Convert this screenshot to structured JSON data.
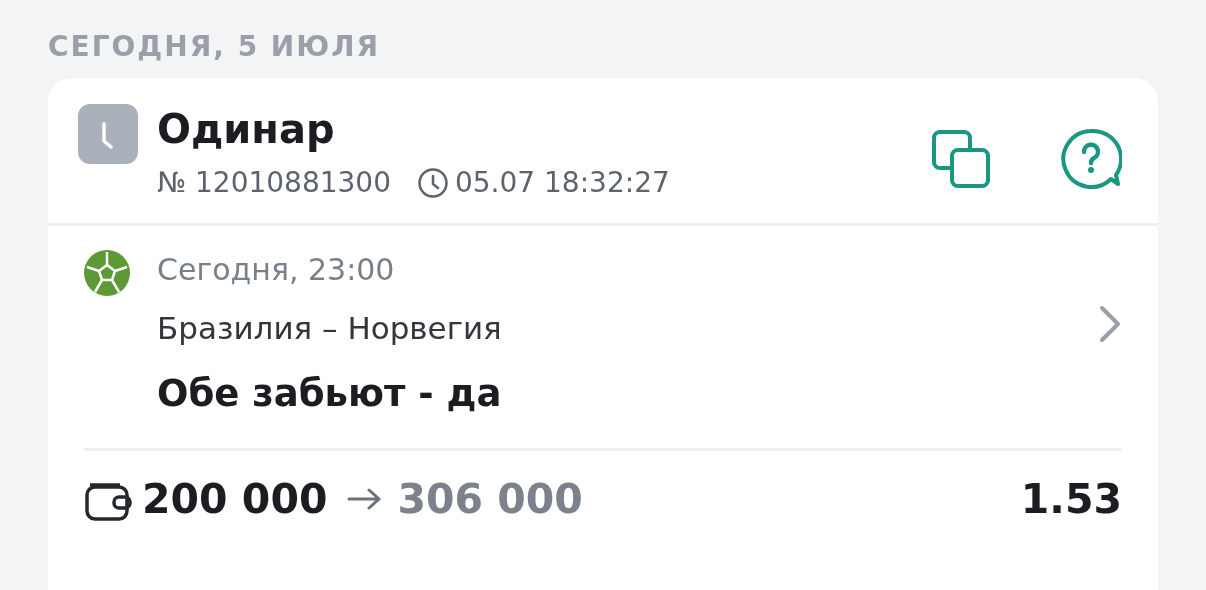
{
  "date_header": "СЕГОДНЯ, 5 ИЮЛЯ",
  "bet": {
    "type": "Одинар",
    "number": "№ 12010881300",
    "placed_at": "05.07 18:32:27"
  },
  "event": {
    "start": "Сегодня, 23:00",
    "match": "Бразилия – Норвегия",
    "outcome": "Обе забьют - да"
  },
  "summary": {
    "stake": "200 000",
    "payout": "306 000",
    "odds": "1.53"
  }
}
